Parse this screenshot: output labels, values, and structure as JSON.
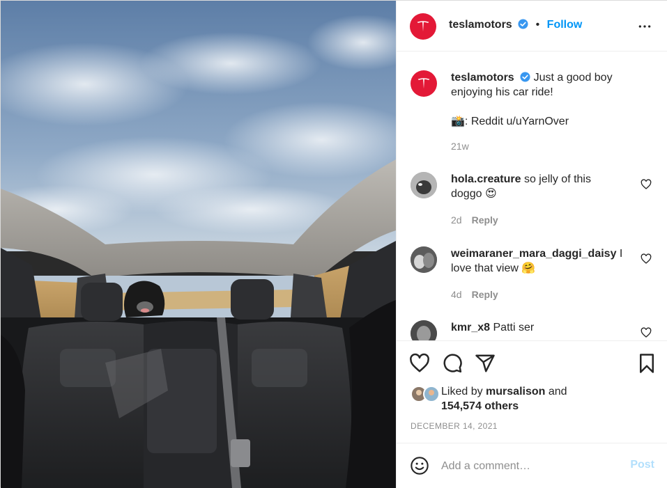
{
  "post": {
    "username": "teslamotors",
    "follow_label": "Follow",
    "separator": "•",
    "caption_line1": "Just a good boy",
    "caption_line2": "enjoying his car ride!",
    "caption_credit": "📸: Reddit u/uYarnOver",
    "caption_age": "21w",
    "image_alt": "Dog sitting in the back seat of a Tesla under the glass roof"
  },
  "comments": [
    {
      "username": "hola.creature",
      "text_a": "so jelly of this",
      "text_b": "doggo 😍",
      "age": "2d",
      "reply_label": "Reply"
    },
    {
      "username": "weimaraner_mara_daggi_daisy",
      "text_a": "I",
      "text_b": "love that view 🤗",
      "age": "4d",
      "reply_label": "Reply"
    },
    {
      "username": "kmr_x8",
      "text_a": "Patti ser",
      "text_b": "",
      "age": "",
      "reply_label": ""
    }
  ],
  "likes": {
    "prefix": "Liked by",
    "user": "mursalison",
    "conj": "and",
    "others": "154,574 others"
  },
  "date": "DECEMBER 14, 2021",
  "comment_box": {
    "placeholder": "Add a comment…",
    "post_label": "Post"
  },
  "colors": {
    "accent": "#0095f6",
    "brand_red": "#e31937",
    "post_disabled": "#b2dffc"
  }
}
